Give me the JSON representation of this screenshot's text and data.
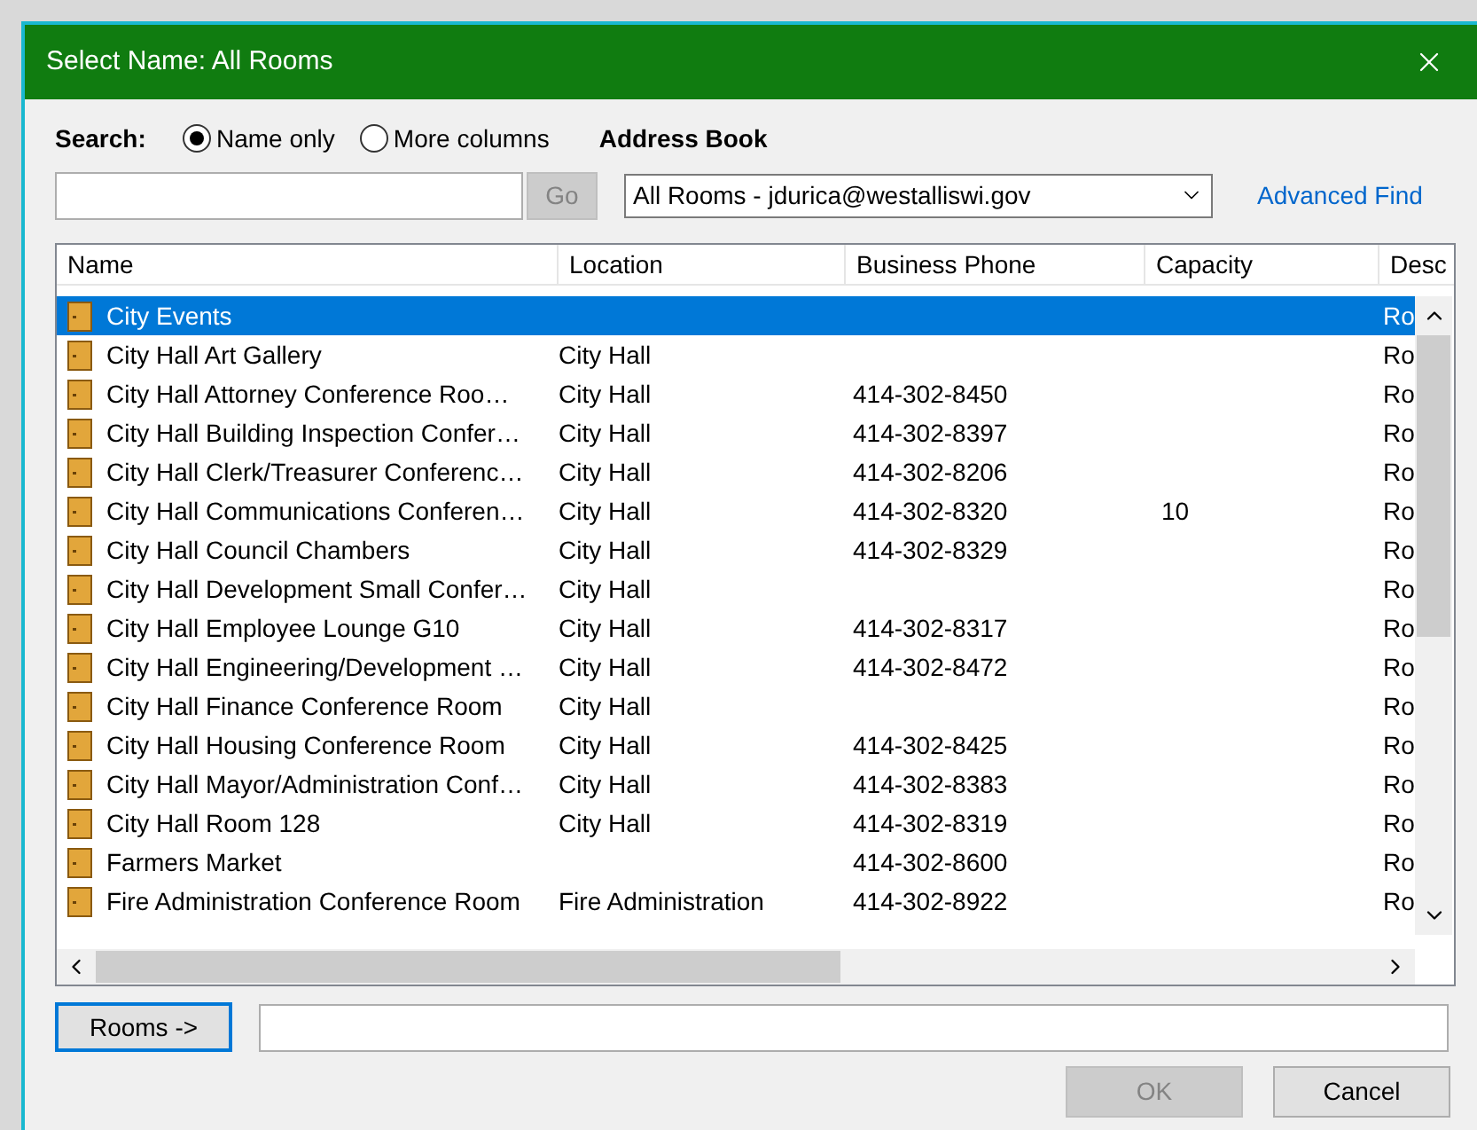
{
  "window": {
    "title": "Select Name: All Rooms"
  },
  "search": {
    "label": "Search:",
    "options": [
      {
        "label": "Name only",
        "selected": true
      },
      {
        "label": "More columns",
        "selected": false
      }
    ],
    "go_button": "Go",
    "go_disabled": true
  },
  "address_book": {
    "label": "Address Book",
    "value": "All Rooms - jdurica@westalliswi.gov",
    "advanced_find": "Advanced Find"
  },
  "table": {
    "columns": [
      "Name",
      "Location",
      "Business Phone",
      "Capacity",
      "Desc"
    ],
    "rows": [
      {
        "name": "City Events",
        "location": "",
        "phone": "",
        "capacity": "",
        "column_5": "Ro",
        "selected": true
      },
      {
        "name": "City Hall Art Gallery",
        "location": "City Hall",
        "phone": "",
        "capacity": "",
        "column_5": "Ro",
        "selected": false
      },
      {
        "name": "City Hall Attorney Conference Roo…",
        "location": "City Hall",
        "phone": "414-302-8450",
        "capacity": "",
        "column_5": "Ro",
        "selected": false
      },
      {
        "name": "City Hall Building Inspection Confer…",
        "location": "City Hall",
        "phone": "414-302-8397",
        "capacity": "",
        "column_5": "Ro",
        "selected": false
      },
      {
        "name": "City Hall Clerk/Treasurer Conferenc…",
        "location": "City Hall",
        "phone": "414-302-8206",
        "capacity": "",
        "column_5": "Ro",
        "selected": false
      },
      {
        "name": "City Hall Communications Conferen…",
        "location": "City Hall",
        "phone": "414-302-8320",
        "capacity": "10",
        "column_5": "Ro",
        "selected": false
      },
      {
        "name": "City Hall Council Chambers",
        "location": "City Hall",
        "phone": "414-302-8329",
        "capacity": "",
        "column_5": "Ro",
        "selected": false
      },
      {
        "name": "City Hall Development Small Confer…",
        "location": "City Hall",
        "phone": "",
        "capacity": "",
        "column_5": "Ro",
        "selected": false
      },
      {
        "name": "City Hall Employee Lounge G10",
        "location": "City Hall",
        "phone": "414-302-8317",
        "capacity": "",
        "column_5": "Ro",
        "selected": false
      },
      {
        "name": "City Hall Engineering/Development …",
        "location": "City Hall",
        "phone": "414-302-8472",
        "capacity": "",
        "column_5": "Ro",
        "selected": false
      },
      {
        "name": "City Hall Finance Conference Room",
        "location": "City Hall",
        "phone": "",
        "capacity": "",
        "column_5": "Ro",
        "selected": false
      },
      {
        "name": "City Hall Housing Conference Room",
        "location": "City Hall",
        "phone": "414-302-8425",
        "capacity": "",
        "column_5": "Ro",
        "selected": false
      },
      {
        "name": "City Hall Mayor/Administration Conf…",
        "location": "City Hall",
        "phone": "414-302-8383",
        "capacity": "",
        "column_5": "Ro",
        "selected": false
      },
      {
        "name": "City Hall Room 128",
        "location": "City Hall",
        "phone": "414-302-8319",
        "capacity": "",
        "column_5": "Ro",
        "selected": false
      },
      {
        "name": "Farmers Market",
        "location": "",
        "phone": "414-302-8600",
        "capacity": "",
        "column_5": "Ro",
        "selected": false
      },
      {
        "name": "Fire Administration Conference Room",
        "location": "Fire Administration",
        "phone": "414-302-8922",
        "capacity": "",
        "column_5": "Ro",
        "selected": false
      }
    ]
  },
  "rooms_button": "Rooms ->",
  "buttons": [
    {
      "label": "OK",
      "disabled": true
    },
    {
      "label": "Cancel",
      "disabled": false
    }
  ]
}
